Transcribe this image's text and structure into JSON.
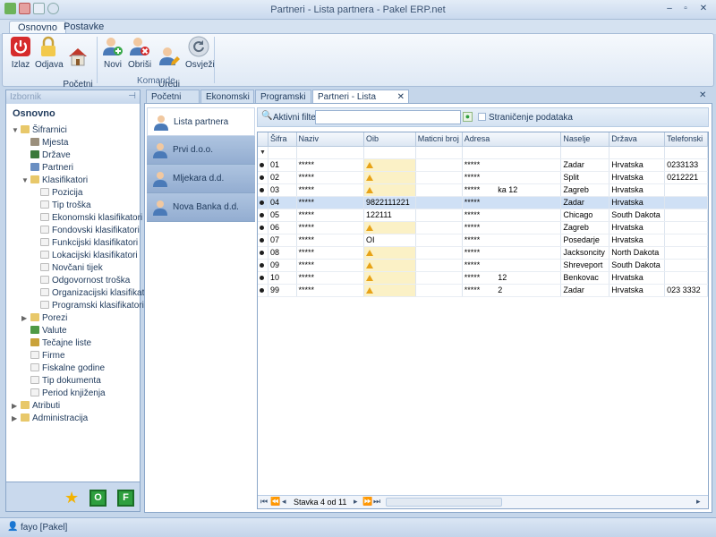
{
  "window": {
    "title": "Partneri - Lista partnera - Pakel ERP.net"
  },
  "ribbon_tabs": [
    "Osnovno",
    "Postavke"
  ],
  "ribbon": {
    "buttons": [
      {
        "label": "Izlaz",
        "icon": "power-icon"
      },
      {
        "label": "Odjava",
        "icon": "lock-icon"
      },
      {
        "label": "Početni\nekran",
        "icon": "home-icon"
      },
      {
        "label": "Novi",
        "icon": "user-add-icon"
      },
      {
        "label": "Obriši",
        "icon": "user-delete-icon"
      },
      {
        "label": "Uredi\npartnera",
        "icon": "user-edit-icon"
      },
      {
        "label": "Osvježi",
        "icon": "refresh-icon"
      }
    ],
    "group_label": "Komande"
  },
  "left_pane": {
    "header": "Izbornik",
    "title": "Osnovno",
    "tree": [
      {
        "label": "Šifrarnici",
        "level": 0,
        "expanded": true,
        "icon": "folder-icon"
      },
      {
        "label": "Mjesta",
        "level": 1,
        "icon": "building-icon"
      },
      {
        "label": "Države",
        "level": 1,
        "icon": "flag-icon"
      },
      {
        "label": "Partneri",
        "level": 1,
        "icon": "users-icon"
      },
      {
        "label": "Klasifikatori",
        "level": 1,
        "expanded": true,
        "icon": "folder-icon"
      },
      {
        "label": "Pozicija",
        "level": 2,
        "icon": "doc-icon"
      },
      {
        "label": "Tip troška",
        "level": 2,
        "icon": "doc-icon"
      },
      {
        "label": "Ekonomski klasifikatori",
        "level": 2,
        "icon": "doc-icon"
      },
      {
        "label": "Fondovski klasifikatori",
        "level": 2,
        "icon": "doc-icon"
      },
      {
        "label": "Funkcijski klasifikatori",
        "level": 2,
        "icon": "doc-icon"
      },
      {
        "label": "Lokacijski klasifikatori",
        "level": 2,
        "icon": "doc-icon"
      },
      {
        "label": "Novčani tijek",
        "level": 2,
        "icon": "doc-icon"
      },
      {
        "label": "Odgovornost troška",
        "level": 2,
        "icon": "doc-icon"
      },
      {
        "label": "Organizacijski klasifikatori",
        "level": 2,
        "icon": "doc-icon"
      },
      {
        "label": "Programski klasifikatori",
        "level": 2,
        "icon": "doc-icon"
      },
      {
        "label": "Porezi",
        "level": 1,
        "collapsed": true,
        "icon": "folder-icon"
      },
      {
        "label": "Valute",
        "level": 1,
        "icon": "money-icon"
      },
      {
        "label": "Tečajne liste",
        "level": 1,
        "icon": "coins-icon"
      },
      {
        "label": "Firme",
        "level": 1,
        "icon": "doc-icon"
      },
      {
        "label": "Fiskalne godine",
        "level": 1,
        "icon": "doc-icon"
      },
      {
        "label": "Tip dokumenta",
        "level": 1,
        "icon": "doc-icon"
      },
      {
        "label": "Period knjiženja",
        "level": 1,
        "icon": "doc-icon"
      },
      {
        "label": "Atributi",
        "level": 0,
        "collapsed": true,
        "icon": "folder-icon"
      },
      {
        "label": "Administracija",
        "level": 0,
        "collapsed": true,
        "icon": "folder-icon"
      }
    ],
    "footer_buttons": [
      "O",
      "F"
    ]
  },
  "doc_tabs": [
    "Početni ekran",
    "Ekonomski kls.",
    "Programski kls.",
    "Partneri - Lista partnera"
  ],
  "partner_nav": [
    "Lista partnera",
    "Prvi d.o.o.",
    "Mljekara d.d.",
    "Nova Banka d.d."
  ],
  "filter": {
    "label": "Aktivni filter",
    "value": "",
    "paging_label": "Straničenje podataka"
  },
  "grid": {
    "columns": [
      "Šifra",
      "Naziv",
      "Oib",
      "Maticni broj",
      "Adresa",
      "Naselje",
      "Država",
      "Telefonski"
    ],
    "rows": [
      {
        "sifra": "01",
        "naziv": "*****",
        "oib": "",
        "warn": true,
        "mb": "",
        "adresa": "*****",
        "naselje": "Zadar",
        "drzava": "Hrvatska",
        "tel": "0233133"
      },
      {
        "sifra": "02",
        "naziv": "*****",
        "oib": "",
        "warn": true,
        "mb": "",
        "adresa": "*****",
        "naselje": "Split",
        "drzava": "Hrvatska",
        "tel": "0212221"
      },
      {
        "sifra": "03",
        "naziv": "*****",
        "oib": "",
        "warn": true,
        "mb": "",
        "adresa": "*****        ka 12",
        "naselje": "Zagreb",
        "drzava": "Hrvatska",
        "tel": ""
      },
      {
        "sifra": "04",
        "naziv": "*****",
        "oib": "9822111221",
        "warn": false,
        "mb": "",
        "adresa": "*****",
        "naselje": "Zadar",
        "drzava": "Hrvatska",
        "tel": "",
        "selected": true
      },
      {
        "sifra": "05",
        "naziv": "*****",
        "oib": "122111",
        "warn": false,
        "mb": "",
        "adresa": "*****",
        "naselje": "Chicago",
        "drzava": "South Dakota",
        "tel": ""
      },
      {
        "sifra": "06",
        "naziv": "*****",
        "oib": "",
        "warn": true,
        "mb": "",
        "adresa": "*****",
        "naselje": "Zagreb",
        "drzava": "Hrvatska",
        "tel": ""
      },
      {
        "sifra": "07",
        "naziv": "*****",
        "oib": "OI",
        "warn": false,
        "mb": "",
        "adresa": "*****",
        "naselje": "Posedarje",
        "drzava": "Hrvatska",
        "tel": ""
      },
      {
        "sifra": "08",
        "naziv": "*****",
        "oib": "",
        "warn": true,
        "mb": "",
        "adresa": "*****",
        "naselje": "Jacksoncity",
        "drzava": "North Dakota",
        "tel": ""
      },
      {
        "sifra": "09",
        "naziv": "*****",
        "oib": "",
        "warn": true,
        "mb": "",
        "adresa": "*****",
        "naselje": "Shreveport",
        "drzava": "South Dakota",
        "tel": ""
      },
      {
        "sifra": "10",
        "naziv": "*****",
        "oib": "",
        "warn": true,
        "mb": "",
        "adresa": "*****        12",
        "naselje": "Benkovac",
        "drzava": "Hrvatska",
        "tel": ""
      },
      {
        "sifra": "99",
        "naziv": "*****",
        "oib": "",
        "warn": true,
        "mb": "",
        "adresa": "*****        2",
        "naselje": "Zadar",
        "drzava": "Hrvatska",
        "tel": "023 3332"
      }
    ],
    "pager": "Stavka 4 od 11"
  },
  "status": {
    "user": "fayo [Pakel]"
  }
}
